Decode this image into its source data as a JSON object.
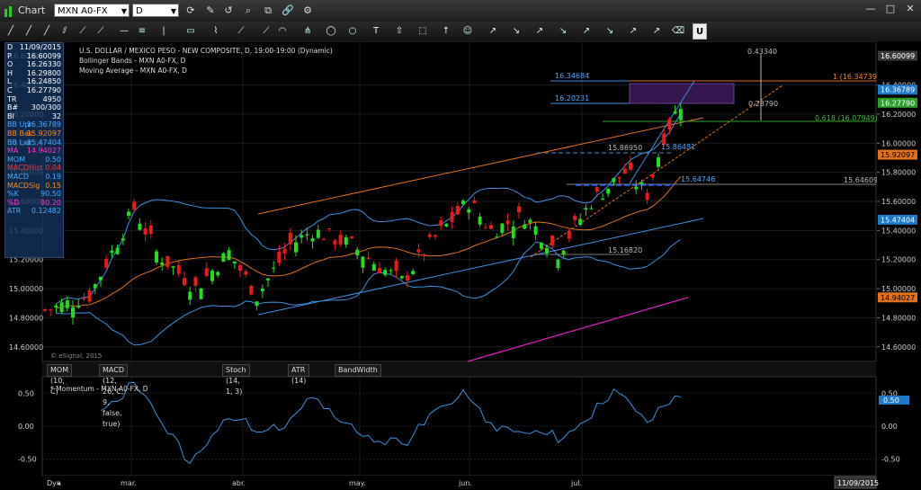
{
  "window": {
    "title": "Chart",
    "symbol": "MXN A0-FX",
    "interval": "D"
  },
  "chart": {
    "legend_lines": [
      "U.S. DOLLAR / MEXICO PESO - NEW COMPOSITE, D, 19:00-19:00 (Dynamic)",
      "Bollinger Bands - MXN A0-FX, D",
      "Moving Average - MXN A0-FX, D"
    ],
    "watermark": "© eSignal, 2015",
    "current_date": "11/09/2015"
  },
  "data_window": [
    {
      "label": "D",
      "value": "11/09/2015",
      "color": "#ffffff"
    },
    {
      "label": "P",
      "value": "16.60099",
      "color": "#ffffff"
    },
    {
      "label": "O",
      "value": "16.26330",
      "color": "#ffffff"
    },
    {
      "label": "H",
      "value": "16.29800",
      "color": "#ffffff"
    },
    {
      "label": "L",
      "value": "16.24850",
      "color": "#ffffff"
    },
    {
      "label": "C",
      "value": "16.27790",
      "color": "#ffffff"
    },
    {
      "label": "TR",
      "value": "4950",
      "color": "#ffffff"
    },
    {
      "label": "B#",
      "value": "300/300",
      "color": "#ffffff"
    },
    {
      "label": "BI",
      "value": "32",
      "color": "#ffffff"
    },
    {
      "label": "BB Upr",
      "value": "16.36789",
      "color": "#4aa8ff"
    },
    {
      "label": "BB Bas",
      "value": "15.92097",
      "color": "#ff8a1e"
    },
    {
      "label": "BB Lwr",
      "value": "15.47404",
      "color": "#4aa8ff"
    },
    {
      "label": "MA",
      "value": "14.94027",
      "color": "#ff33cc"
    },
    {
      "label": "MOM",
      "value": "0.50",
      "color": "#4aa8ff"
    },
    {
      "label": "MACDHist",
      "value": "0.04",
      "color": "#ff3333"
    },
    {
      "label": "MACD",
      "value": "0.19",
      "color": "#4aa8ff"
    },
    {
      "label": "MACDSig",
      "value": "0.15",
      "color": "#ff8a1e"
    },
    {
      "label": "%K",
      "value": "90.50",
      "color": "#4aa8ff"
    },
    {
      "label": "%D",
      "value": "90.20",
      "color": "#ff33cc"
    },
    {
      "label": "ATR",
      "value": "0.12482",
      "color": "#4aa8ff"
    }
  ],
  "price_axis": {
    "ticks": [
      "16.40000",
      "16.20000",
      "16.00000",
      "15.80000",
      "15.60000",
      "15.40000",
      "15.20000",
      "15.00000",
      "14.80000",
      "14.60000"
    ],
    "left_ticks": [
      "16.60099",
      "16.40000",
      "16.20000",
      "16.00000",
      "15.80000",
      "15.60000",
      "15.40000",
      "15.20000",
      "15.00000",
      "14.80000",
      "14.60000"
    ],
    "range": [
      14.5,
      16.7
    ]
  },
  "price_tags": [
    {
      "value": "16.60099",
      "price": 16.60099,
      "bg": "#3b3b3b",
      "fg": "#ffffff"
    },
    {
      "value": "16.36789",
      "price": 16.36789,
      "bg": "#1f78c8",
      "fg": "#ffffff"
    },
    {
      "value": "16.27790",
      "price": 16.2779,
      "bg": "#2f9e2f",
      "fg": "#ffffff"
    },
    {
      "value": "15.92097",
      "price": 15.92097,
      "bg": "#e0701a",
      "fg": "#000000"
    },
    {
      "value": "15.47404",
      "price": 15.47404,
      "bg": "#1f78c8",
      "fg": "#ffffff"
    },
    {
      "value": "14.94027",
      "price": 14.94027,
      "bg": "#e0701a",
      "fg": "#000000"
    }
  ],
  "annotations": [
    {
      "text": "0.43340",
      "color": "#bbbbbb"
    },
    {
      "text": "1 (16.34739)",
      "color": "#ff8a1e"
    },
    {
      "text": "0.618 (16.07949)",
      "color": "#3fbf3f"
    },
    {
      "text": "0.28790",
      "color": "#bbbbbb"
    },
    {
      "text": "16.34684",
      "color": "#4aa8ff"
    },
    {
      "text": "16.20231",
      "color": "#4aa8ff"
    },
    {
      "text": "15.86950",
      "color": "#bbbbbb"
    },
    {
      "text": "15.86481",
      "color": "#4aa8ff"
    },
    {
      "text": "15.64746",
      "color": "#4aa8ff"
    },
    {
      "text": "15.64609",
      "color": "#bbbbbb"
    },
    {
      "text": "15.16820",
      "color": "#bbbbbb"
    }
  ],
  "months": [
    "mar.",
    "abr.",
    "may.",
    "jun.",
    "jul."
  ],
  "study_tabs": [
    "MOM (10, C)",
    "MACD (12, 26, C, 9, false, true)",
    "Stoch (14, 1, 3)",
    "ATR (14)",
    "BandWidth"
  ],
  "momentum": {
    "legend": "* Momentum - MXN A0-FX, D",
    "ticks": [
      "0.50",
      "0.00",
      "-0.50"
    ],
    "tag": "0.50",
    "range": [
      -0.75,
      0.75
    ]
  },
  "footer": {
    "dyn_label": "Dyn"
  },
  "colors": {
    "up": "#22dd22",
    "down": "#ee1a1a",
    "bb": "#3d8fe0",
    "bbmid": "#e0701a",
    "ma": "#e020c0",
    "mom": "#3d8fe0"
  }
}
